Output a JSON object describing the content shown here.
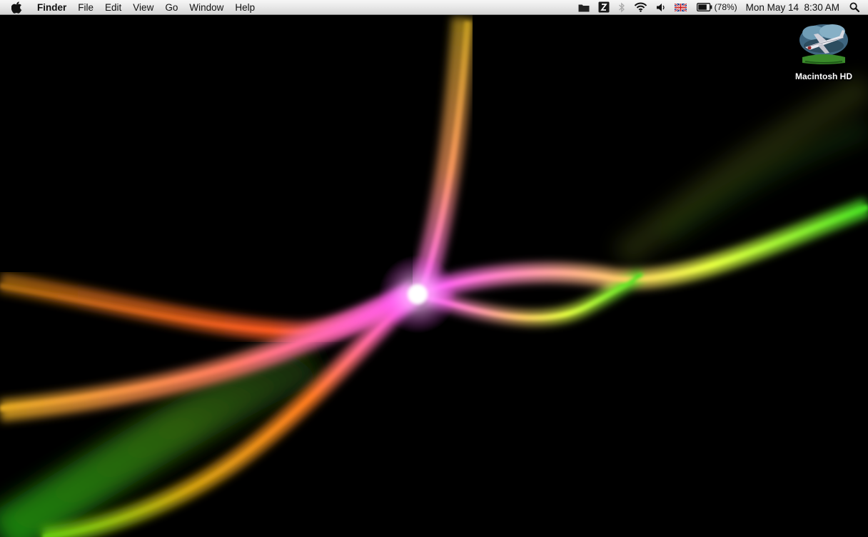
{
  "menubar": {
    "apple_icon": "apple-logo-icon",
    "app_name": "Finder",
    "menus": [
      "File",
      "Edit",
      "View",
      "Go",
      "Window",
      "Help"
    ],
    "status_icons": [
      "folder-icon",
      "app-status-icon",
      "bluetooth-icon",
      "wifi-icon",
      "volume-icon",
      "uk-flag-icon"
    ],
    "battery_percent": "(78%)",
    "battery_level": 0.78,
    "clock": "Mon May 14  8:30 AM",
    "spotlight_icon": "spotlight-search-icon"
  },
  "desktop": {
    "icons": [
      {
        "label": "Macintosh HD",
        "icon": "airplane-drive-icon"
      }
    ]
  },
  "colors": {
    "background": "#000000",
    "menubar_top": "#f7f7f7",
    "menubar_bottom": "#d4d4d4"
  }
}
